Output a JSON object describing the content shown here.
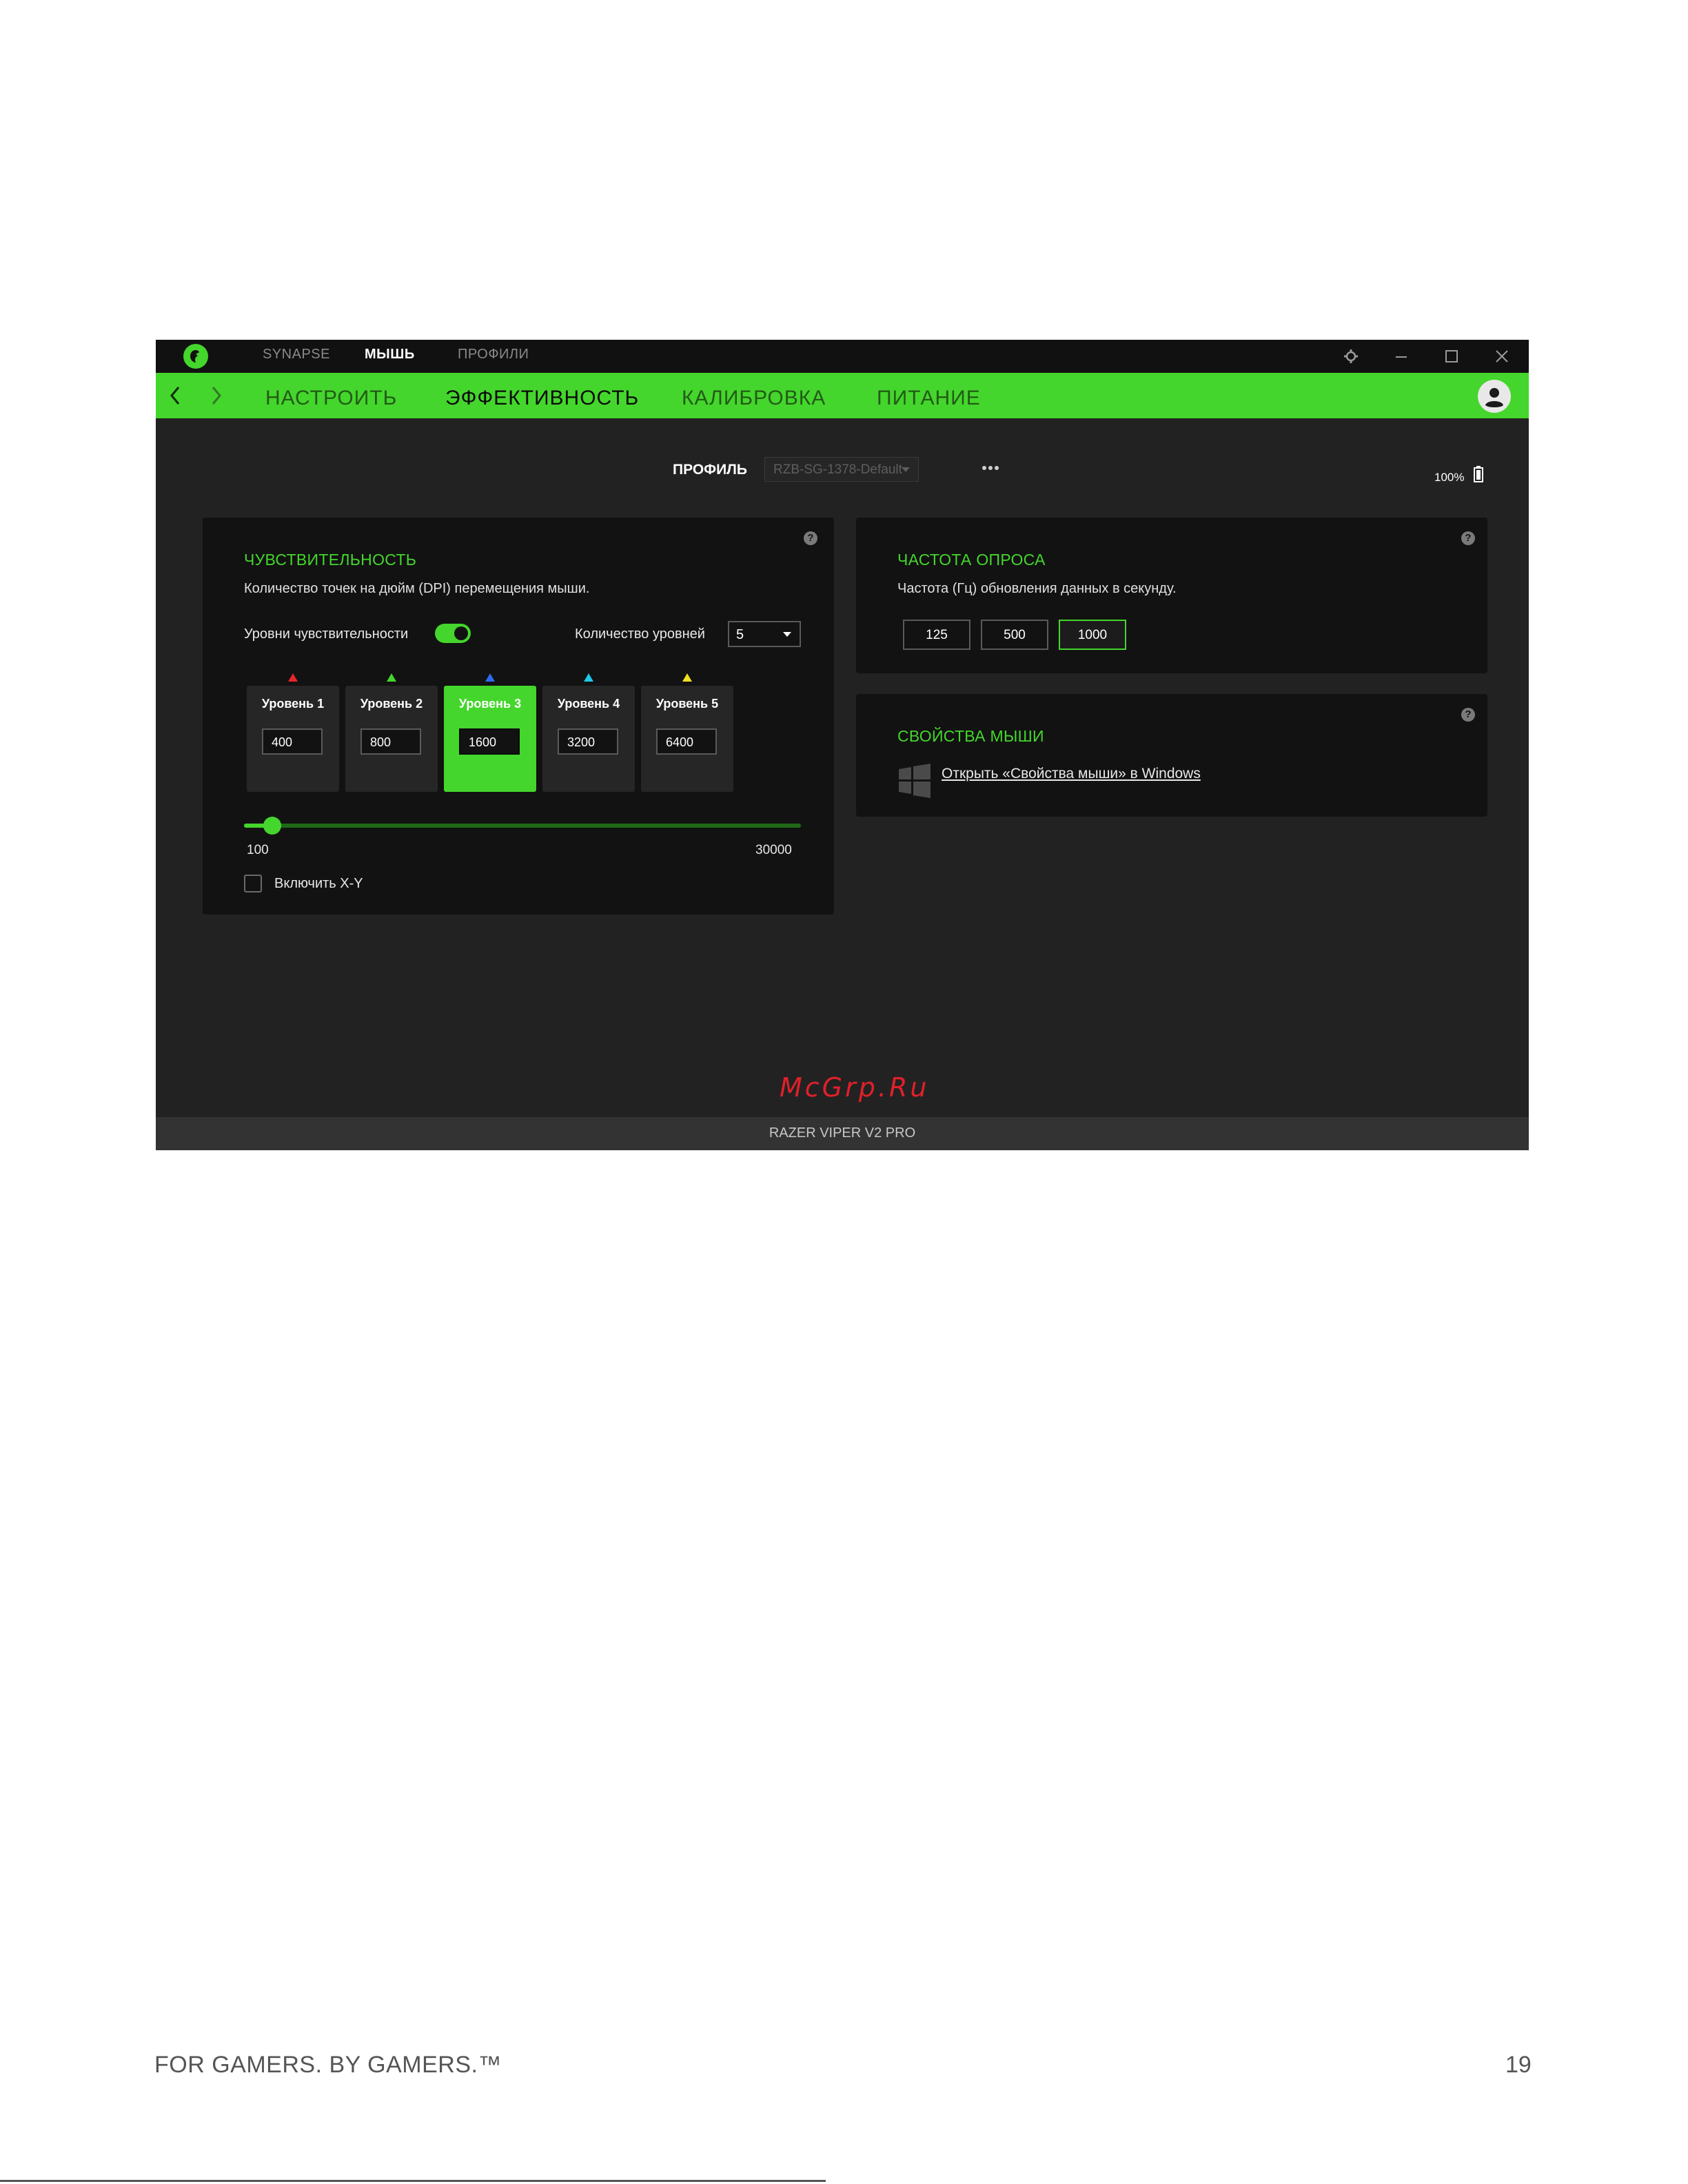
{
  "window": {
    "top_tabs": [
      "SYNAPSE",
      "МЫШЬ",
      "ПРОФИЛИ"
    ],
    "active_top_tab": "МЫШЬ"
  },
  "nav": {
    "tabs": [
      "НАСТРОИТЬ",
      "ЭФФЕКТИВНОСТЬ",
      "КАЛИБРОВКА",
      "ПИТАНИЕ"
    ],
    "active_tab": "ЭФФЕКТИВНОСТЬ"
  },
  "profile": {
    "label": "ПРОФИЛЬ",
    "value": "RZB-SG-1378-Default"
  },
  "battery": {
    "percent_label": "100%",
    "level": 1.0
  },
  "sensitivity": {
    "title": "ЧУВСТВИТЕЛЬНОСТЬ",
    "description": "Количество точек на дюйм (DPI) перемещения мыши.",
    "stages_label": "Уровни чувствительности",
    "stages_enabled": true,
    "stage_count_label": "Количество уровней",
    "stage_count_value": "5",
    "levels": [
      {
        "title": "Уровень 1",
        "value": "400",
        "marker_color": "#e8262a"
      },
      {
        "title": "Уровень 2",
        "value": "800",
        "marker_color": "#44d62c"
      },
      {
        "title": "Уровень 3",
        "value": "1600",
        "marker_color": "#2d6cf0"
      },
      {
        "title": "Уровень 4",
        "value": "3200",
        "marker_color": "#1ec8e8"
      },
      {
        "title": "Уровень 5",
        "value": "6400",
        "marker_color": "#f0e020"
      }
    ],
    "active_level": 3,
    "slider_min_label": "100",
    "slider_max_label": "30000",
    "slider_min": 100,
    "slider_max": 30000,
    "slider_value": 1600,
    "xy_label": "Включить X-Y",
    "xy_enabled": false
  },
  "polling": {
    "title": "ЧАСТОТА ОПРОСА",
    "description": "Частота (Гц) обновления данных в секунду.",
    "rates": [
      "125",
      "500",
      "1000"
    ],
    "active_rate": "1000"
  },
  "mouse_props": {
    "title": "СВОЙСТВА МЫШИ",
    "link": "Открыть «Свойства мыши» в Windows"
  },
  "watermark": "McGrp.Ru",
  "device_name": "RAZER VIPER V2 PRO",
  "footer": {
    "tagline": "FOR GAMERS. BY GAMERS.™",
    "page_number": "19"
  },
  "colors": {
    "accent": "#44d62c",
    "background": "#222222",
    "panel": "#121212"
  }
}
